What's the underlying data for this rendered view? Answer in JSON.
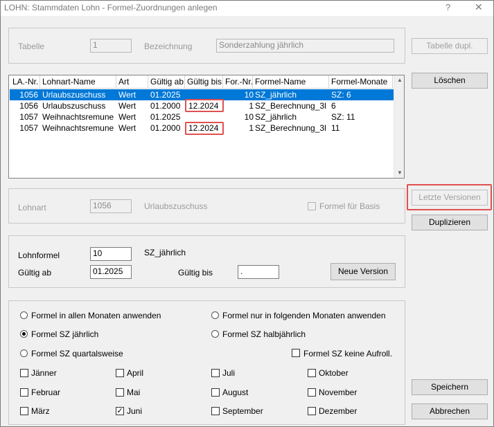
{
  "window": {
    "title": "LOHN: Stammdaten Lohn - Formel-Zuordnungen anlegen",
    "help": "?",
    "close": "✕"
  },
  "top": {
    "tabelle_label": "Tabelle",
    "tabelle_value": "1",
    "bezeichnung_label": "Bezeichnung",
    "bezeichnung_value": "Sonderzahlung jährlich"
  },
  "buttons": {
    "tabelle_dupl": "Tabelle dupl.",
    "loeschen": "Löschen",
    "letzte_versionen": "Letzte Versionen",
    "duplizieren": "Duplizieren",
    "neue_version": "Neue Version",
    "speichern": "Speichern",
    "abbrechen": "Abbrechen"
  },
  "list": {
    "columns": [
      "LA.-Nr.",
      "Lohnart-Name",
      "Art",
      "Gültig ab",
      "Gültig bis",
      "For.-Nr.",
      "Formel-Name",
      "Formel-Monate"
    ],
    "rows": [
      [
        "1056",
        "Urlaubszuschuss",
        "Wert",
        "01.2025",
        "",
        "10",
        "SZ_jährlich",
        "SZ: 6"
      ],
      [
        "1056",
        "Urlaubszuschuss",
        "Wert",
        "01.2000",
        "12.2024",
        "1",
        "SZ_Berechnung_3l",
        "6"
      ],
      [
        "1057",
        "Weihnachtsremune",
        "Wert",
        "01.2025",
        "",
        "10",
        "SZ_jährlich",
        "SZ: 11"
      ],
      [
        "1057",
        "Weihnachtsremune",
        "Wert",
        "01.2000",
        "12.2024",
        "1",
        "SZ_Berechnung_3l",
        "11"
      ]
    ]
  },
  "lohnart": {
    "label": "Lohnart",
    "value": "1056",
    "name": "Urlaubszuschuss",
    "formel_basis": "Formel für Basis"
  },
  "formel": {
    "lohnformel_label": "Lohnformel",
    "lohnformel_value": "10",
    "lohnformel_name": "SZ_jährlich",
    "gueltig_ab_label": "Gültig ab",
    "gueltig_ab_value": "01.2025",
    "gueltig_bis_label": "Gültig bis",
    "gueltig_bis_value": "."
  },
  "options": {
    "r1": "Formel in allen Monaten anwenden",
    "r2": "Formel nur in folgenden Monaten anwenden",
    "r3": "Formel SZ jährlich",
    "r4": "Formel SZ halbjährlich",
    "r5": "Formel SZ quartalsweise",
    "keine_aufroll": "Formel SZ keine Aufroll.",
    "selected_radio": "Formel SZ jährlich"
  },
  "months": [
    {
      "name": "Jänner",
      "checked": false
    },
    {
      "name": "April",
      "checked": false
    },
    {
      "name": "Juli",
      "checked": false
    },
    {
      "name": "Oktober",
      "checked": false
    },
    {
      "name": "Februar",
      "checked": false
    },
    {
      "name": "Mai",
      "checked": false
    },
    {
      "name": "August",
      "checked": false
    },
    {
      "name": "November",
      "checked": false
    },
    {
      "name": "März",
      "checked": false
    },
    {
      "name": "Juni",
      "checked": true
    },
    {
      "name": "September",
      "checked": false
    },
    {
      "name": "Dezember",
      "checked": false
    }
  ],
  "colors": {
    "selection": "#0078d7",
    "highlight": "#e05050"
  }
}
